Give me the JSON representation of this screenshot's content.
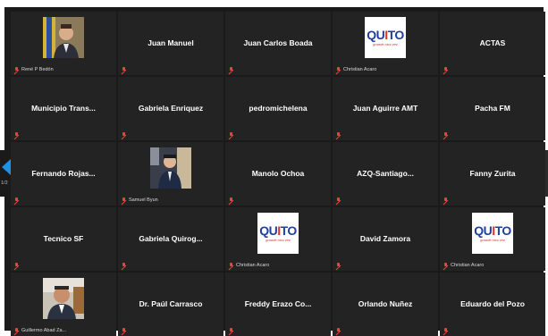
{
  "pager": {
    "page_label": "1/2"
  },
  "tiles": [
    {
      "name": "",
      "caption": "René P Bedón",
      "type": "photo"
    },
    {
      "name": "Juan Manuel",
      "caption": "",
      "type": "name"
    },
    {
      "name": "Juan Carlos Boada",
      "caption": "",
      "type": "name"
    },
    {
      "name": "",
      "caption": "Christian Acaro",
      "type": "logo"
    },
    {
      "name": "ACTAS",
      "caption": "",
      "type": "name"
    },
    {
      "name": "Municipio Trans...",
      "caption": "",
      "type": "name"
    },
    {
      "name": "Gabriela Enriquez",
      "caption": "",
      "type": "name"
    },
    {
      "name": "pedromichelena",
      "caption": "",
      "type": "name"
    },
    {
      "name": "Juan Aguirre AMT",
      "caption": "",
      "type": "name"
    },
    {
      "name": "Pacha FM",
      "caption": "",
      "type": "name"
    },
    {
      "name": "Fernando Rojas...",
      "caption": "",
      "type": "name"
    },
    {
      "name": "",
      "caption": "Samuel Byun",
      "type": "photo"
    },
    {
      "name": "Manolo Ochoa",
      "caption": "",
      "type": "name"
    },
    {
      "name": "AZQ-Santiago...",
      "caption": "",
      "type": "name"
    },
    {
      "name": "Fanny Zurita",
      "caption": "",
      "type": "name"
    },
    {
      "name": "Tecnico SF",
      "caption": "",
      "type": "name"
    },
    {
      "name": "Gabriela Quirog...",
      "caption": "",
      "type": "name"
    },
    {
      "name": "",
      "caption": "Christian Acaro",
      "type": "logo"
    },
    {
      "name": "David Zamora",
      "caption": "",
      "type": "name"
    },
    {
      "name": "",
      "caption": "Christian Acaro",
      "type": "logo"
    },
    {
      "name": "",
      "caption": "Guillermo Abad Za...",
      "type": "photo"
    },
    {
      "name": "Dr. Paúl Carrasco",
      "caption": "",
      "type": "name"
    },
    {
      "name": "Freddy Erazo Co...",
      "caption": "",
      "type": "name"
    },
    {
      "name": "Orlando Nuñez",
      "caption": "",
      "type": "name"
    },
    {
      "name": "Eduardo del Pozo",
      "caption": "",
      "type": "name"
    }
  ],
  "logo": {
    "word_a": "QU",
    "word_i": "I",
    "word_b": "TO",
    "tagline": "grande otra vez"
  },
  "colors": {
    "background": "#1a1a1a",
    "tile": "#232323",
    "muted_mic": "#e04a3c",
    "nav_arrow": "#1e90e6"
  }
}
